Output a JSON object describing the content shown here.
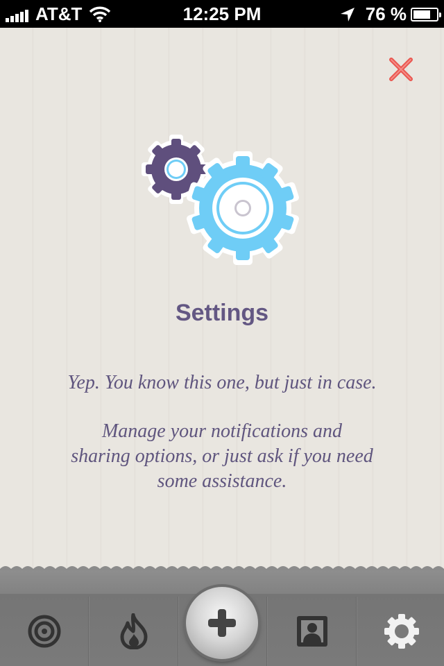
{
  "status_bar": {
    "carrier": "AT&T",
    "time": "12:25 PM",
    "battery_percent": "76 %",
    "battery_level": 0.76,
    "signal_bars": 5,
    "icons": [
      "signal-bars-icon",
      "wifi-icon",
      "location-arrow-icon",
      "battery-icon"
    ]
  },
  "panel": {
    "close_icon": "close-x-icon",
    "illustration": "gears-icon",
    "title": "Settings",
    "line1": "Yep. You know this one, but just in case.",
    "para2_line1": "Manage your notifications and",
    "para2_line2": "sharing options, or just ask if you need",
    "para2_line3": "some assistance."
  },
  "colors": {
    "accent_purple": "#635783",
    "gear_blue": "#6fcdf6",
    "gear_purple": "#5f4f7d",
    "close_red": "#f0605a"
  },
  "tab_bar": {
    "tabs": [
      {
        "icon": "target-icon"
      },
      {
        "icon": "flame-icon"
      },
      {
        "icon": "plus-icon"
      },
      {
        "icon": "contact-card-icon"
      },
      {
        "icon": "gear-icon"
      }
    ]
  }
}
